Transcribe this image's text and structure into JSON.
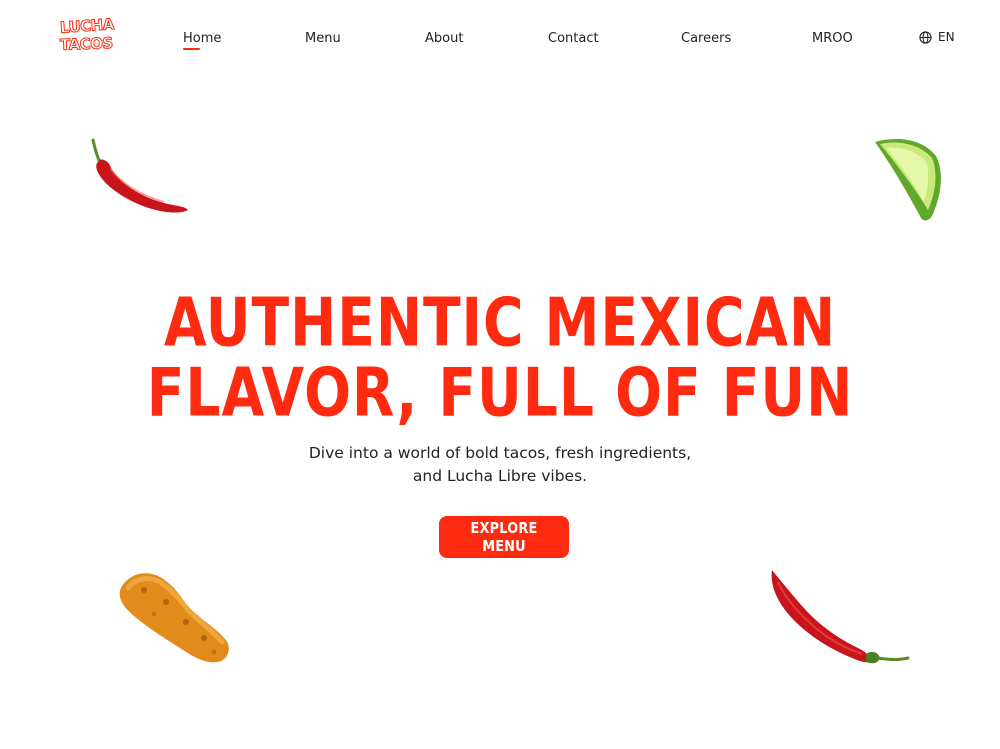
{
  "brand": {
    "logo_line1": "LUCHA",
    "logo_line2": "TACOS",
    "accent_color": "#ff2a10"
  },
  "nav": {
    "items": [
      {
        "label": "Home",
        "active": true
      },
      {
        "label": "Menu"
      },
      {
        "label": "About"
      },
      {
        "label": "Contact"
      },
      {
        "label": "Careers"
      },
      {
        "label": "MROO"
      }
    ],
    "language": {
      "label": "EN",
      "icon": "globe-icon"
    }
  },
  "hero": {
    "headline_line1": "AUTHENTIC MEXICAN",
    "headline_line2": "FLAVOR, FULL OF FUN",
    "subtext_line1": "Dive into a world of bold tacos, fresh ingredients,",
    "subtext_line2": "and Lucha Libre vibes.",
    "cta_label": "EXPLORE MENU"
  },
  "decorations": [
    {
      "name": "chili-pepper-top-left"
    },
    {
      "name": "lime-wedge-top-right"
    },
    {
      "name": "fried-chicken-strip-bottom-left"
    },
    {
      "name": "chili-pepper-bottom-right"
    }
  ]
}
